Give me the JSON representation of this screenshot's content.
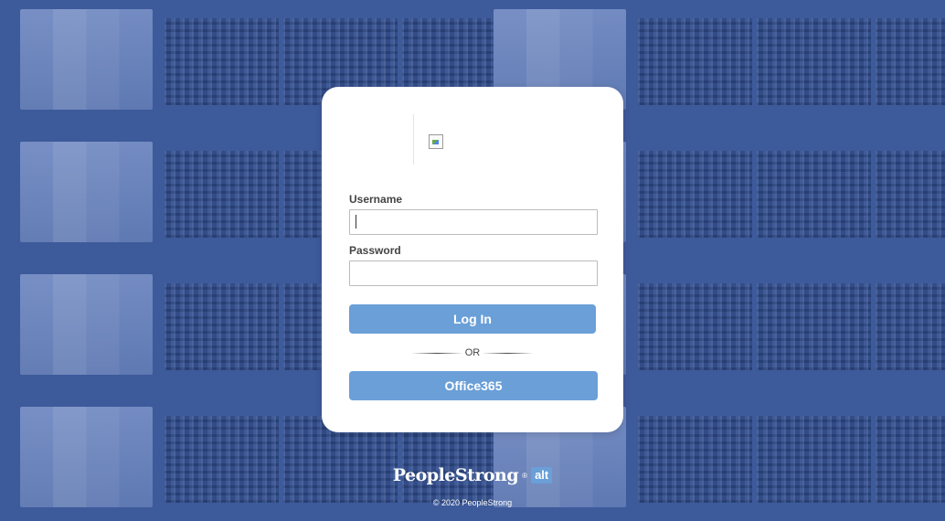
{
  "login": {
    "username_label": "Username",
    "username_value": "",
    "password_label": "Password",
    "password_value": "",
    "login_button": "Log In",
    "or_text": "OR",
    "office_button": "Office365"
  },
  "footer": {
    "brand_name": "PeopleStrong",
    "brand_reg": "®",
    "brand_badge": "alt",
    "copyright": "© 2020 PeopleStrong"
  },
  "colors": {
    "background": "#3d5a9b",
    "button": "#6a9fd8",
    "card": "#ffffff"
  },
  "icons": {
    "logo": "broken-image-icon"
  }
}
